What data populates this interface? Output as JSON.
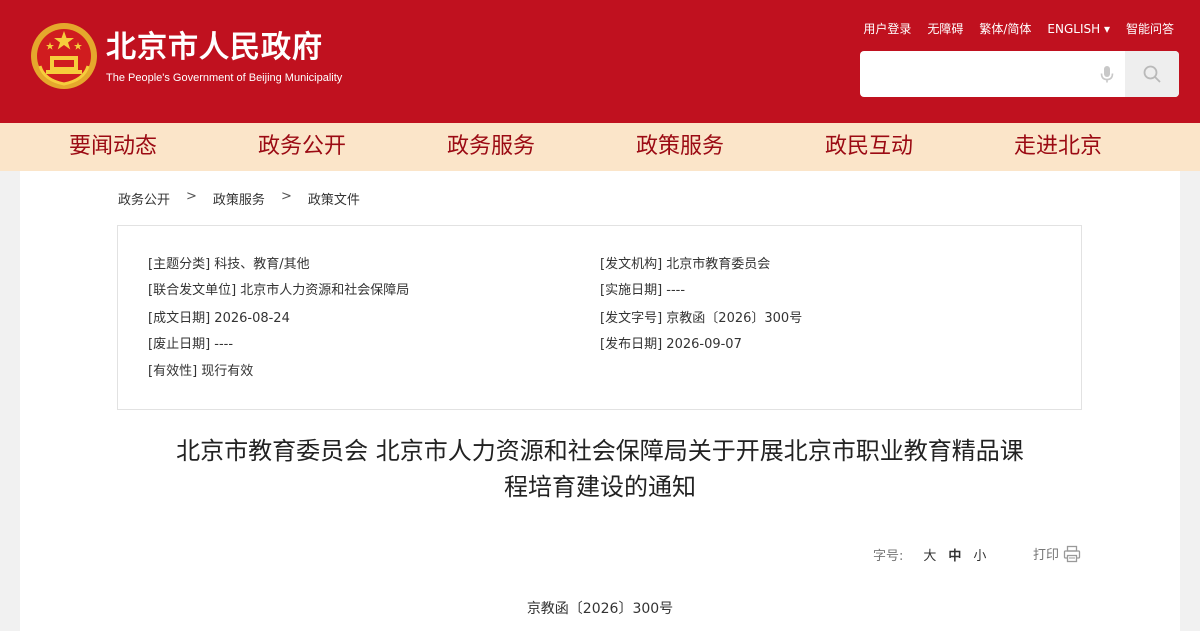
{
  "header": {
    "title": "北京市人民政府",
    "subtitle": "The People's Government of Beijing Municipality",
    "links": [
      "用户登录",
      "无障碍",
      "繁体/简体",
      "ENGLISH ▾",
      "智能问答"
    ],
    "search_placeholder": "",
    "emblem_icon": "national-emblem-icon",
    "colors": {
      "header_bg": "#c0111f",
      "nav_bg": "#fbe5c9",
      "nav_text": "#9b0a13"
    }
  },
  "nav": {
    "items": [
      "要闻动态",
      "政务公开",
      "政务服务",
      "政策服务",
      "政民互动",
      "走进北京"
    ]
  },
  "breadcrumb": {
    "items": [
      "政务公开",
      "政策服务",
      "政策文件"
    ],
    "separator": ">"
  },
  "info": {
    "category_key": "[主题分类]",
    "category_val": "科技、教育/其他",
    "joint_key": "[联合发文单位]",
    "joint_val": "北京市人力资源和社会保障局",
    "created_key": "[成文日期]",
    "created_val": "2026-08-24",
    "repealed_key": "[废止日期]",
    "repealed_val": "----",
    "validity_key": "[有效性]",
    "validity_val": "现行有效",
    "issuer_key": "[发文机构]",
    "issuer_val": "北京市教育委员会",
    "effective_key": "[实施日期]",
    "effective_val": "----",
    "docno_key": "[发文字号]",
    "docno_val": "京教函〔2026〕300号",
    "published_key": "[发布日期]",
    "published_val": "2026-09-07"
  },
  "document": {
    "title_line1": "北京市教育委员会 北京市人力资源和社会保障局关于开展北京市职业教育精品课",
    "title_line2": "程培育建设的通知",
    "font_size_label": "字号:",
    "font_sizes": [
      "大",
      "中",
      "小"
    ],
    "print_label": "打印",
    "number": "京教函〔2026〕300号"
  }
}
